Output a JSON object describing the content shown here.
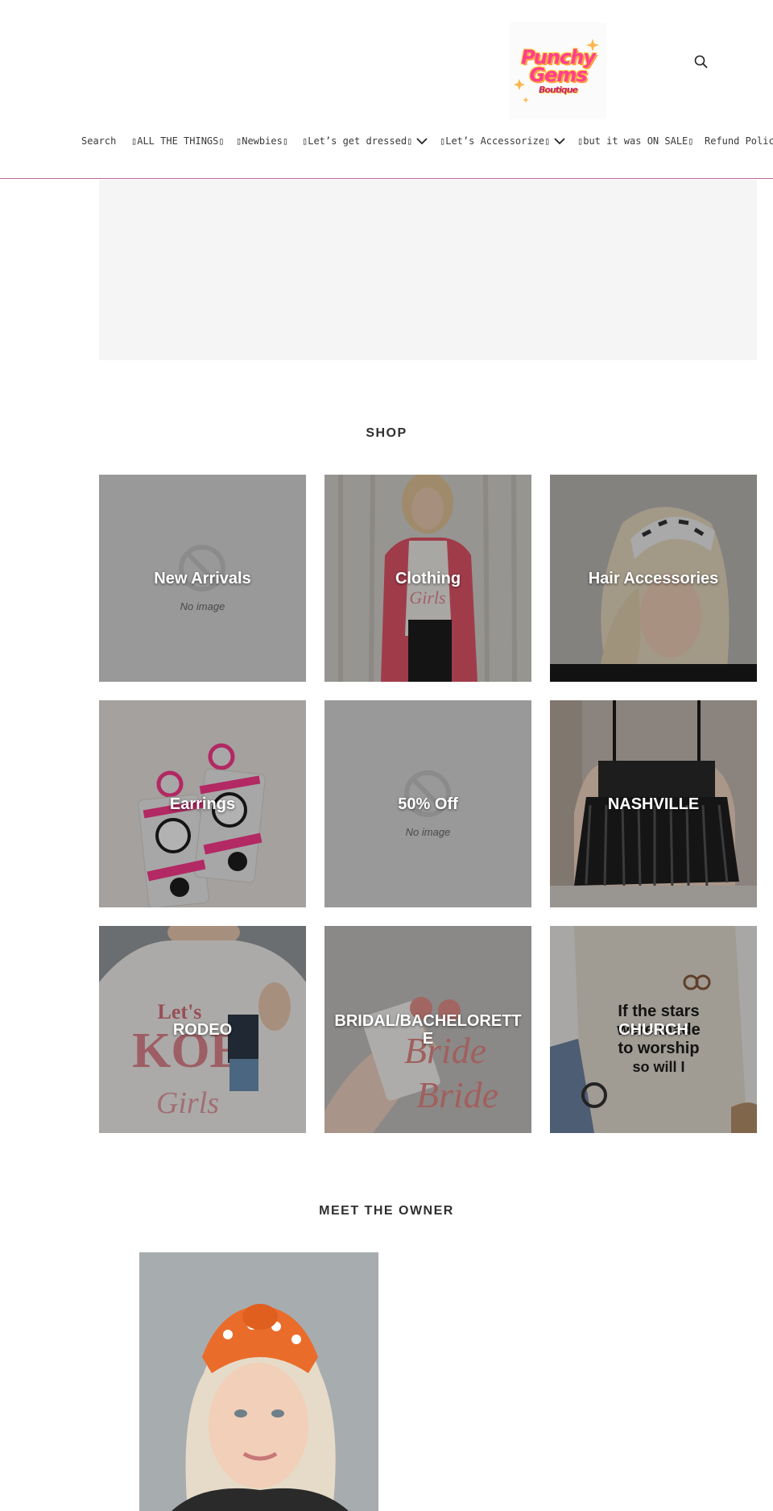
{
  "header": {
    "logo": {
      "line1": "Punchy",
      "line2": "Gems",
      "line3": "Boutique"
    },
    "search_icon": "search-icon"
  },
  "nav": {
    "items": [
      {
        "label": "Search",
        "has_dropdown": false
      },
      {
        "label": "ALL THE THINGS",
        "has_dropdown": false
      },
      {
        "label": "Newbies",
        "has_dropdown": false
      },
      {
        "label": "Let’s get dressed",
        "has_dropdown": true
      },
      {
        "label": "Let’s Accessorize",
        "has_dropdown": true
      },
      {
        "label": "but it was ON SALE",
        "has_dropdown": false
      },
      {
        "label": "Refund Policy",
        "has_dropdown": false
      }
    ]
  },
  "shop": {
    "title": "SHOP",
    "collections": [
      {
        "label": "New Arrivals",
        "no_image_text": "No image"
      },
      {
        "label": "Clothing"
      },
      {
        "label": "Hair Accessories"
      },
      {
        "label": "Earrings"
      },
      {
        "label": "50% Off",
        "no_image_text": "No image"
      },
      {
        "label": "NASHVILLE"
      },
      {
        "label": "RODEO"
      },
      {
        "label": "BRIDAL/BACHELORETTE"
      },
      {
        "label": "CHURCH"
      }
    ]
  },
  "owner": {
    "title": "MEET THE OWNER"
  },
  "colors": {
    "accent_border": "#b9699f",
    "logo_pink": "#ff3f8e",
    "logo_orange": "#ff9f45"
  }
}
